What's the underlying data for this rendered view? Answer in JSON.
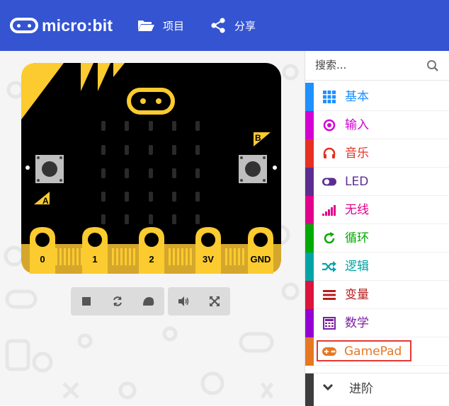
{
  "header": {
    "logo_text": "micro:bit",
    "projects_label": "项目",
    "share_label": "分享",
    "background": "#3454d1"
  },
  "board": {
    "button_a": "A",
    "button_b": "B",
    "pins": [
      "0",
      "1",
      "2",
      "3V",
      "GND"
    ]
  },
  "sim_controls": [
    {
      "icon": "stop-icon"
    },
    {
      "icon": "restart-icon"
    },
    {
      "icon": "slow-mo-icon"
    },
    {
      "icon": "mute-icon"
    },
    {
      "icon": "fullscreen-icon"
    }
  ],
  "toolbox": {
    "search_placeholder": "搜索...",
    "categories": [
      {
        "label": "基本",
        "color": "#1e90ff",
        "icon": "grid-icon"
      },
      {
        "label": "输入",
        "color": "#d400d4",
        "icon": "radio-target-icon"
      },
      {
        "label": "音乐",
        "color": "#e63022",
        "icon": "headphones-icon"
      },
      {
        "label": "LED",
        "color": "#5c2d91",
        "icon": "toggle-icon"
      },
      {
        "label": "无线",
        "color": "#e3008c",
        "icon": "signal-icon"
      },
      {
        "label": "循环",
        "color": "#00aa00",
        "icon": "refresh-icon"
      },
      {
        "label": "逻辑",
        "color": "#00a4a6",
        "icon": "shuffle-icon"
      },
      {
        "label": "变量",
        "color": "#dc143c",
        "icon": "lines-icon"
      },
      {
        "label": "数学",
        "color": "#9400d3",
        "icon": "calculator-icon"
      },
      {
        "label": "GamePad",
        "color": "#e87722",
        "icon": "gamepad-icon"
      }
    ],
    "advanced_label": "进阶"
  }
}
